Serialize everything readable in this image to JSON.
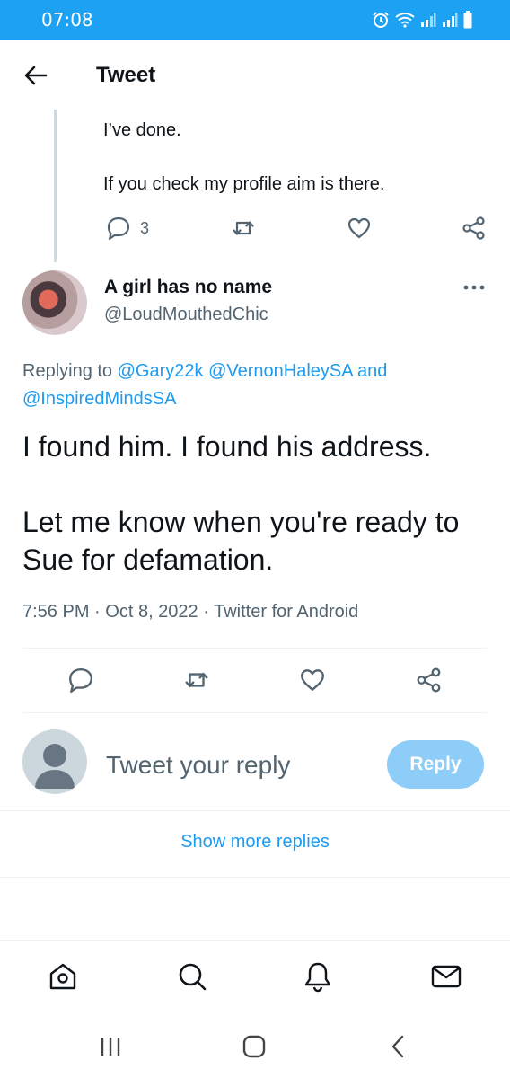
{
  "status_bar": {
    "time": "07:08",
    "icons": [
      "alarm-icon",
      "wifi-icon",
      "signal-icon",
      "signal-icon",
      "battery-icon"
    ]
  },
  "header": {
    "title": "Tweet",
    "back_icon": "arrow-left-icon"
  },
  "previous_tweet": {
    "text_line_1": "I’ve done.",
    "text_line_2": "If you check my profile aim is there.",
    "reply_count": "3"
  },
  "tweet": {
    "display_name": "A girl has no name",
    "handle": "@LoudMouthedChic",
    "replying_prefix": "Replying to",
    "mention_1": "@Gary22k",
    "mention_2": "@VernonHaleySA",
    "replying_and": "and",
    "mention_3": "@InspiredMindsSA",
    "text_paragraph_1": "I found him. I found his address.",
    "text_paragraph_2": "Let me know when you're ready to Sue for defamation.",
    "time": "7:56 PM",
    "date": "Oct 8, 2022",
    "source": "Twitter for Android",
    "separator": "·"
  },
  "reply_box": {
    "placeholder": "Tweet your reply",
    "button_label": "Reply"
  },
  "show_more_replies": "Show more replies",
  "bottom_nav": [
    "home-icon",
    "search-icon",
    "notifications-icon",
    "messages-icon"
  ],
  "system_nav": [
    "recent-apps-icon",
    "home-button-icon",
    "back-icon"
  ],
  "colors": {
    "status_bar": "#1da1f2",
    "accent": "#1d9bf0",
    "reply_button": "#8ecdf8",
    "secondary_text": "#536471",
    "divider": "#eff3f4"
  }
}
